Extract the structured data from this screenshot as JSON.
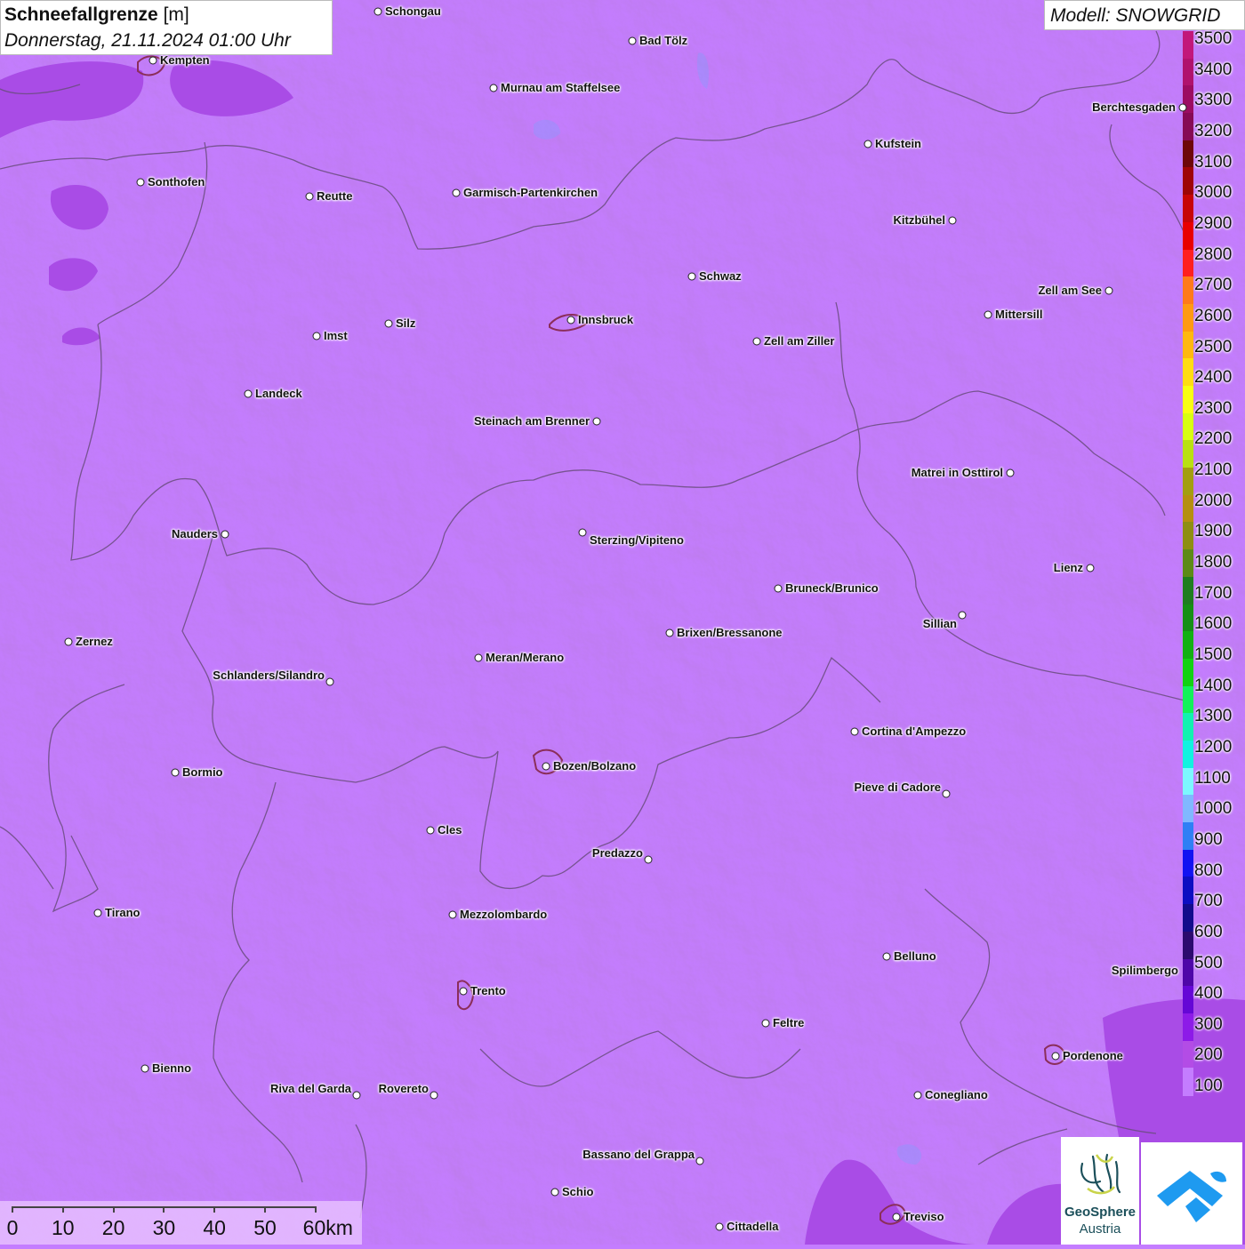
{
  "title": {
    "main": "Schneefallgrenze",
    "unit": "[m]",
    "datetime": "Donnerstag, 21.11.2024 01:00 Uhr"
  },
  "model_label": "Modell: SNOWGRID",
  "colors": {
    "field": "#c47dff",
    "field_low": "#a94ce6",
    "borders": "#6a4c7e",
    "city_outline": "#8b2e5a"
  },
  "legend": {
    "labels": [
      "3500",
      "3400",
      "3300",
      "3200",
      "3100",
      "3000",
      "2900",
      "2800",
      "2700",
      "2600",
      "2500",
      "2400",
      "2300",
      "2200",
      "2100",
      "2000",
      "1900",
      "1800",
      "1700",
      "1600",
      "1500",
      "1400",
      "1300",
      "1200",
      "1100",
      "1000",
      "900",
      "800",
      "700",
      "600",
      "500",
      "400",
      "300",
      "200",
      "100"
    ],
    "colors": [
      "#c2177a",
      "#b0126d",
      "#9c0c62",
      "#860a55",
      "#6d0707",
      "#9e0505",
      "#c70505",
      "#e80000",
      "#ff1f1f",
      "#ff7a1a",
      "#ff9a12",
      "#ffb810",
      "#ffdd12",
      "#f8ff12",
      "#d8ff12",
      "#b9e012",
      "#a39e10",
      "#b58f10",
      "#8e8e12",
      "#5d8a18",
      "#1f7d1f",
      "#168f16",
      "#12b012",
      "#12d212",
      "#12f25a",
      "#12f2b0",
      "#12f2e0",
      "#7cf8ff",
      "#80b8ff",
      "#2f7ff5",
      "#1212f2",
      "#0d0ec2",
      "#120c8c",
      "#2c0a6e",
      "#4e07a8",
      "#6507d6",
      "#8d1ae8",
      "#b34ce6",
      "#c47dff"
    ]
  },
  "cities": [
    {
      "name": "Schongau"
    },
    {
      "name": "Bad Tölz"
    },
    {
      "name": "Kempten"
    },
    {
      "name": "Murnau am Staffelsee"
    },
    {
      "name": "Berchtesgaden"
    },
    {
      "name": "Kufstein"
    },
    {
      "name": "Sonthofen"
    },
    {
      "name": "Reutte"
    },
    {
      "name": "Garmisch-Partenkirchen"
    },
    {
      "name": "Kitzbühel"
    },
    {
      "name": "Schwaz"
    },
    {
      "name": "Zell am See"
    },
    {
      "name": "Innsbruck"
    },
    {
      "name": "Mittersill"
    },
    {
      "name": "Imst"
    },
    {
      "name": "Silz"
    },
    {
      "name": "Zell am Ziller"
    },
    {
      "name": "Landeck"
    },
    {
      "name": "Steinach am Brenner"
    },
    {
      "name": "Matrei in Osttirol"
    },
    {
      "name": "Nauders"
    },
    {
      "name": "Sterzing/Vipiteno"
    },
    {
      "name": "Lienz"
    },
    {
      "name": "Bruneck/Brunico"
    },
    {
      "name": "Sillian"
    },
    {
      "name": "Brixen/Bressanone"
    },
    {
      "name": "Zernez"
    },
    {
      "name": "Meran/Merano"
    },
    {
      "name": "Schlanders/Silandro"
    },
    {
      "name": "Cortina d'Ampezzo"
    },
    {
      "name": "Bozen/Bolzano"
    },
    {
      "name": "Bormio"
    },
    {
      "name": "Pieve di Cadore"
    },
    {
      "name": "Cles"
    },
    {
      "name": "Predazzo"
    },
    {
      "name": "Tirano"
    },
    {
      "name": "Mezzolombardo"
    },
    {
      "name": "Belluno"
    },
    {
      "name": "Spilimbergo"
    },
    {
      "name": "Trento"
    },
    {
      "name": "Feltre"
    },
    {
      "name": "Pordenone"
    },
    {
      "name": "Bienno"
    },
    {
      "name": "Riva del Garda"
    },
    {
      "name": "Rovereto"
    },
    {
      "name": "Conegliano"
    },
    {
      "name": "Bassano del Grappa"
    },
    {
      "name": "Schio"
    },
    {
      "name": "Treviso"
    },
    {
      "name": "Cittadella"
    }
  ],
  "scale": {
    "labels": [
      "0",
      "10",
      "20",
      "30",
      "40",
      "50",
      "60km"
    ]
  },
  "logo": {
    "line1": "GeoSphere",
    "line2": "Austria"
  }
}
